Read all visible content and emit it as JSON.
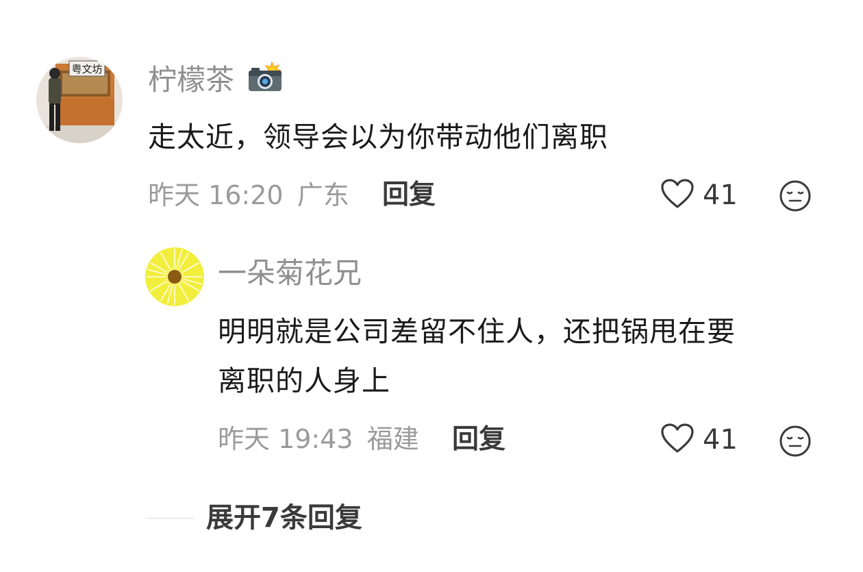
{
  "comment": {
    "username": "柠檬茶",
    "badge_icon": "camera-with-flash-icon",
    "text": "走太近，领导会以为你带动他们离职",
    "time": "昨天 16:20",
    "location": "广东",
    "reply_label": "回复",
    "likes": "41",
    "avatar_sign_text": "粤文坊"
  },
  "reply": {
    "username": "一朵菊花兄",
    "text_line1": "明明就是公司差留不住人，还把锅甩在要",
    "text_line2": "离职的人身上",
    "time": "昨天 19:43",
    "location": "福建",
    "reply_label": "回复",
    "likes": "41"
  },
  "expand": {
    "label": "展开7条回复"
  },
  "colors": {
    "username": "#8f8f8f",
    "content": "#1a1a1a",
    "meta": "#9a9a9a",
    "action": "#3a3a3a",
    "daisy_petal": "#f2ee3e"
  }
}
